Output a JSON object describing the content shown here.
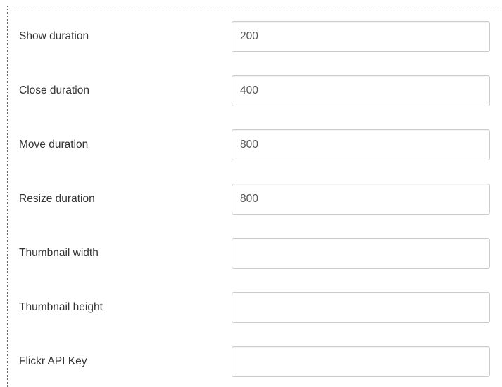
{
  "settings": {
    "fields": [
      {
        "label": "Show duration",
        "value": "200"
      },
      {
        "label": "Close duration",
        "value": "400"
      },
      {
        "label": "Move duration",
        "value": "800"
      },
      {
        "label": "Resize duration",
        "value": "800"
      },
      {
        "label": "Thumbnail width",
        "value": ""
      },
      {
        "label": "Thumbnail height",
        "value": ""
      },
      {
        "label": "Flickr API Key",
        "value": ""
      }
    ]
  }
}
